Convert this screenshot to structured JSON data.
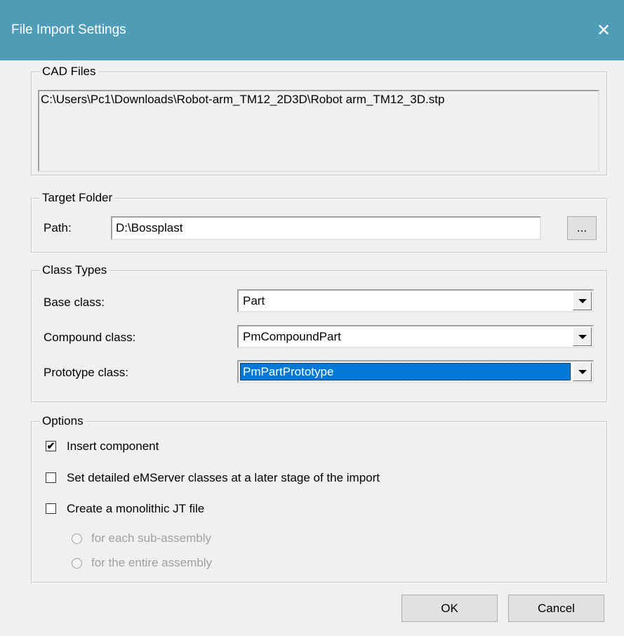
{
  "window": {
    "title": "File Import Settings",
    "close_glyph": "✕"
  },
  "cad_files": {
    "legend": "CAD Files",
    "path": "C:\\Users\\Pc1\\Downloads\\Robot-arm_TM12_2D3D\\Robot arm_TM12_3D.stp"
  },
  "target_folder": {
    "legend": "Target Folder",
    "path_label": "Path:",
    "path_value": "D:\\Bossplast",
    "browse_label": "..."
  },
  "class_types": {
    "legend": "Class Types",
    "base_label": "Base class:",
    "base_value": "Part",
    "compound_label": "Compound class:",
    "compound_value": "PmCompoundPart",
    "prototype_label": "Prototype class:",
    "prototype_value": "PmPartPrototype"
  },
  "options": {
    "legend": "Options",
    "insert_component": {
      "label": "Insert component",
      "checked": true,
      "mark": "✔"
    },
    "set_detailed": {
      "label": "Set detailed eMServer classes at a later stage of the import",
      "checked": false
    },
    "monolithic": {
      "label": "Create a monolithic JT file",
      "checked": false
    },
    "radio_sub": {
      "label": "for each sub-assembly",
      "enabled": false
    },
    "radio_entire": {
      "label": "for the entire assembly",
      "enabled": false
    }
  },
  "buttons": {
    "ok": "OK",
    "cancel": "Cancel"
  },
  "colors": {
    "titlebar": "#4f9cb7",
    "selection": "#0078d7",
    "dialog_bg": "#f0f0f0"
  }
}
